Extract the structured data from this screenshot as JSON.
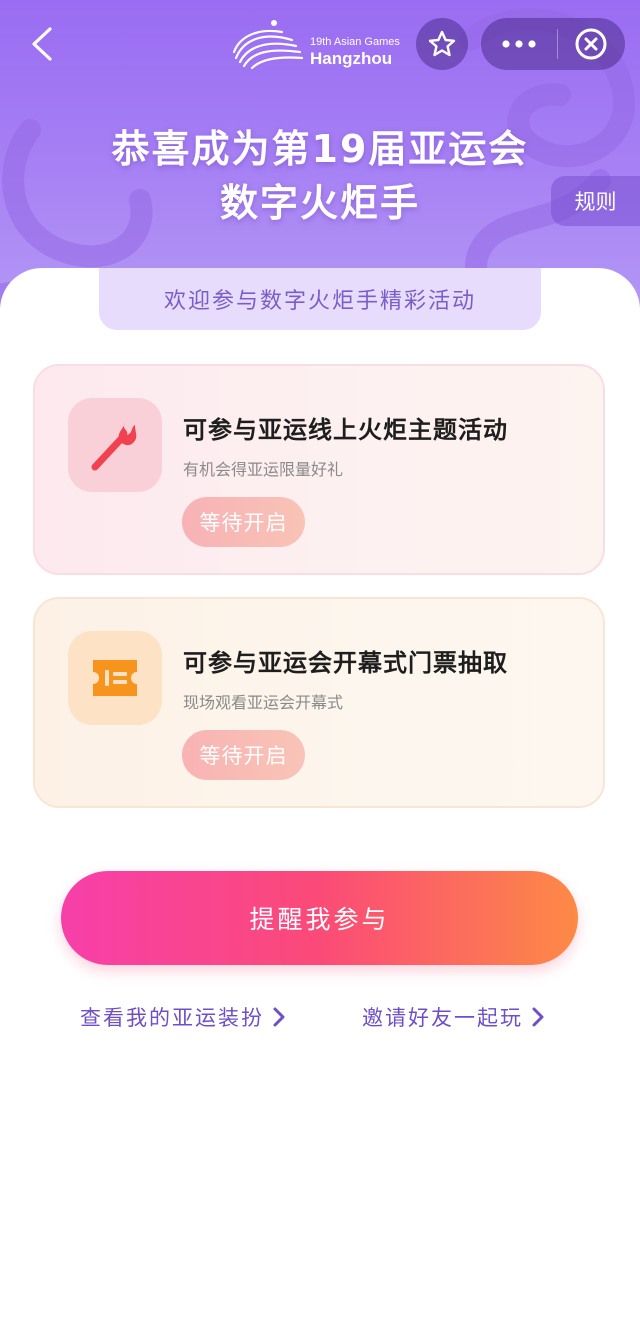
{
  "header": {
    "logo_line1": "19th Asian Games",
    "logo_line2": "Hangzhou",
    "title_line1": "恭喜成为第19届亚运会",
    "title_line2": "数字火炬手",
    "rules_label": "规则"
  },
  "icons": {
    "back": "back-arrow-icon",
    "star": "star-icon",
    "more": "more-dots-icon",
    "close": "close-circle-icon",
    "torch": "torch-icon",
    "ticket": "ticket-icon",
    "chevron": "chevron-right-icon"
  },
  "welcome": "欢迎参与数字火炬手精彩活动",
  "cards": [
    {
      "title": "可参与亚运线上火炬主题活动",
      "subtitle": "有机会得亚运限量好礼",
      "button": "等待开启"
    },
    {
      "title": "可参与亚运会开幕式门票抽取",
      "subtitle": "现场观看亚运会开幕式",
      "button": "等待开启"
    }
  ],
  "cta_label": "提醒我参与",
  "links": {
    "left": "查看我的亚运装扮",
    "right": "邀请好友一起玩"
  },
  "colors": {
    "hero": "#9a6cf2",
    "accent_purple": "#6f4fc8",
    "cta_start": "#f73fa9",
    "cta_end": "#fd8a45",
    "torch": "#f0424f",
    "ticket": "#f7941e"
  }
}
